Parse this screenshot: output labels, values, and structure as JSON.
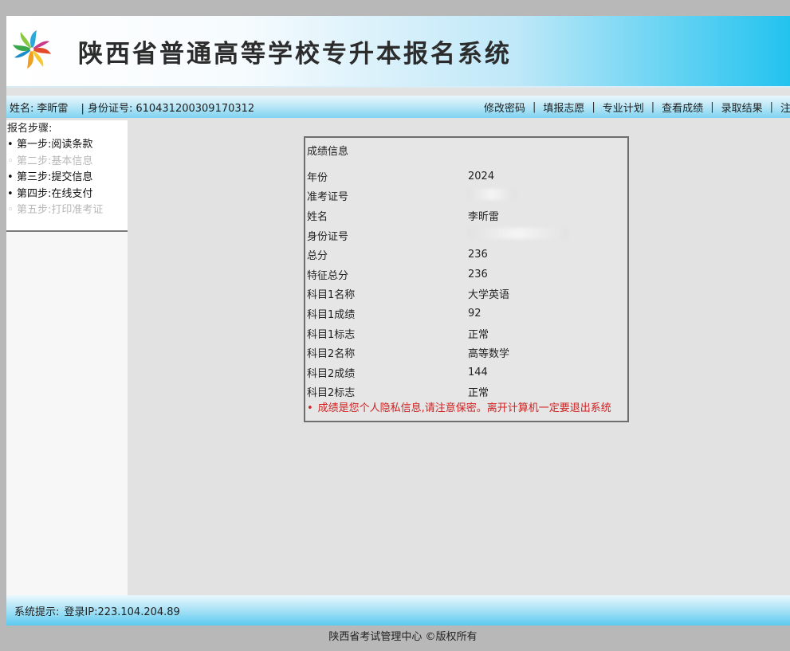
{
  "header": {
    "title": "陕西省普通高等学校专升本报名系统",
    "logo_icon": "pinwheel-logo-icon"
  },
  "userbar": {
    "name_label": "姓名:",
    "name_value": "李昕雷",
    "separator": "|",
    "id_label": "身份证号:",
    "id_value": "610431200309170312",
    "nav": [
      {
        "label": "修改密码"
      },
      {
        "label": "填报志愿"
      },
      {
        "label": "专业计划"
      },
      {
        "label": "查看成绩"
      },
      {
        "label": "录取结果"
      },
      {
        "label": "注销"
      }
    ]
  },
  "sidebar": {
    "title": "报名步骤:",
    "steps": [
      {
        "label": "第一步:阅读条款",
        "state": "active"
      },
      {
        "label": "第二步:基本信息",
        "state": "inactive"
      },
      {
        "label": "第三步:提交信息",
        "state": "active"
      },
      {
        "label": "第四步:在线支付",
        "state": "active"
      },
      {
        "label": "第五步:打印准考证",
        "state": "inactive"
      }
    ]
  },
  "score": {
    "title": "成绩信息",
    "rows": [
      {
        "label": "年份",
        "value": "2024"
      },
      {
        "label": "准考证号",
        "value": ""
      },
      {
        "label": "姓名",
        "value": "李昕雷"
      },
      {
        "label": "身份证号",
        "value": ""
      },
      {
        "label": "总分",
        "value": "236"
      },
      {
        "label": "特征总分",
        "value": "236"
      },
      {
        "label": "科目1名称",
        "value": "大学英语"
      },
      {
        "label": "科目1成绩",
        "value": "92"
      },
      {
        "label": "科目1标志",
        "value": "正常"
      },
      {
        "label": "科目2名称",
        "value": "高等数学"
      },
      {
        "label": "科目2成绩",
        "value": "144"
      },
      {
        "label": "科目2标志",
        "value": "正常"
      }
    ],
    "notice": "成绩是您个人隐私信息,请注意保密。离开计算机一定要退出系统"
  },
  "statusbar": {
    "label": "系统提示:",
    "text": "登录IP:223.104.204.89"
  },
  "footer": {
    "text": "陕西省考试管理中心 ©版权所有"
  },
  "colors": {
    "notice": "#d22020",
    "banner_accent": "#22c3ef",
    "inactive_step": "#b8b8b8"
  }
}
